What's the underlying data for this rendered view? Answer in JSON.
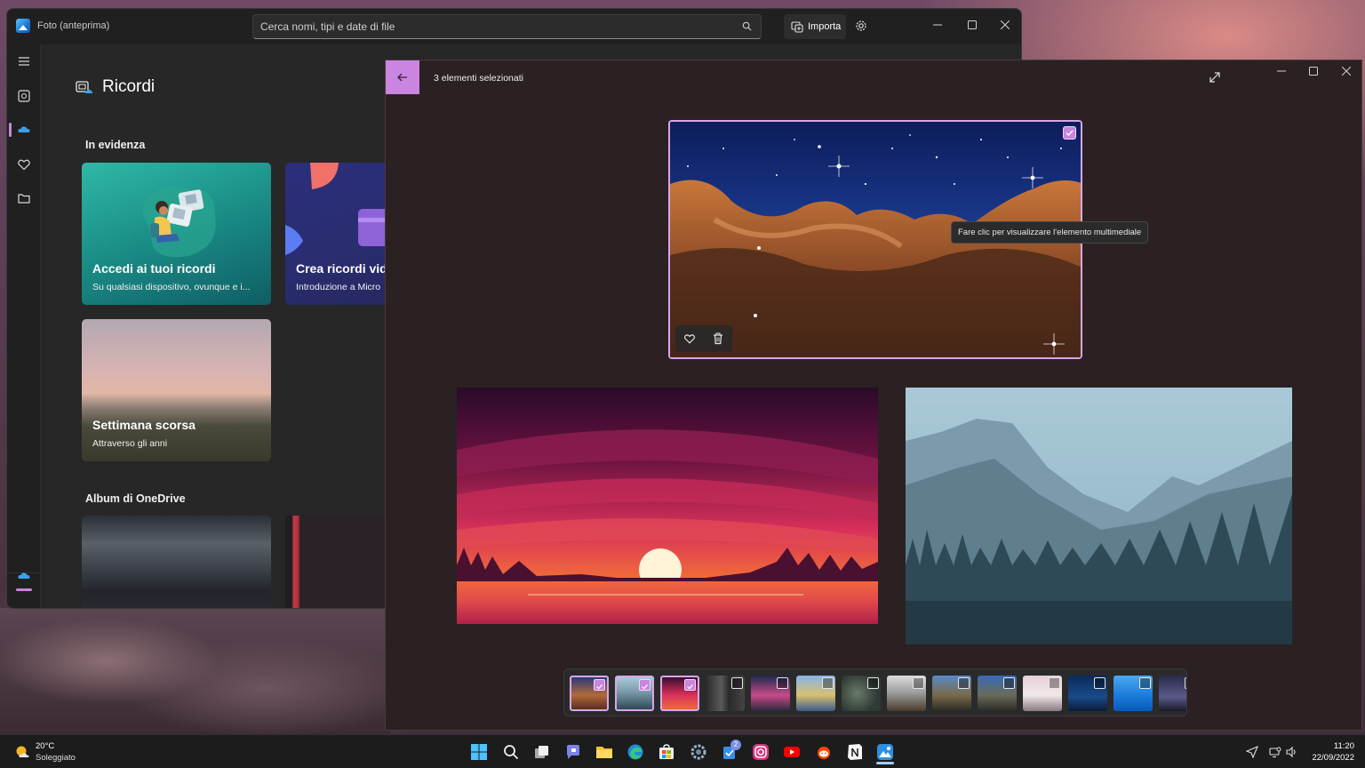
{
  "photos_app": {
    "title": "Foto (anteprima)",
    "search": {
      "placeholder": "Cerca nomi, tipi e date di file"
    },
    "import_label": "Importa",
    "page_title": "Ricordi",
    "sections": {
      "featured": "In evidenza",
      "onedrive_albums": "Album di OneDrive"
    },
    "featured_cards": [
      {
        "title": "Accedi ai tuoi ricordi",
        "subtitle": "Su qualsiasi dispositivo, ovunque e i..."
      },
      {
        "title": "Crea ricordi vid",
        "subtitle": "Introduzione a Micro"
      },
      {
        "title": "Settimana scorsa",
        "subtitle": "Attraverso gli anni"
      }
    ]
  },
  "viewer": {
    "selection_count": "3 elementi selezionati",
    "tooltip": "Fare clic per visualizzare l'elemento multimediale",
    "accent": "#c985df",
    "filmstrip": {
      "thumbnails": [
        {
          "selected": true
        },
        {
          "selected": true
        },
        {
          "selected": true
        },
        {
          "selected": false
        },
        {
          "selected": false
        },
        {
          "selected": false
        },
        {
          "selected": false
        },
        {
          "selected": false
        },
        {
          "selected": false
        },
        {
          "selected": false
        },
        {
          "selected": false
        },
        {
          "selected": false
        },
        {
          "selected": false
        },
        {
          "selected": false
        }
      ]
    }
  },
  "taskbar": {
    "weather": {
      "temperature": "20°C",
      "condition": "Soleggiato"
    },
    "notification_badge": "2",
    "clock": {
      "time": "11:20",
      "date": "22/09/2022"
    }
  }
}
